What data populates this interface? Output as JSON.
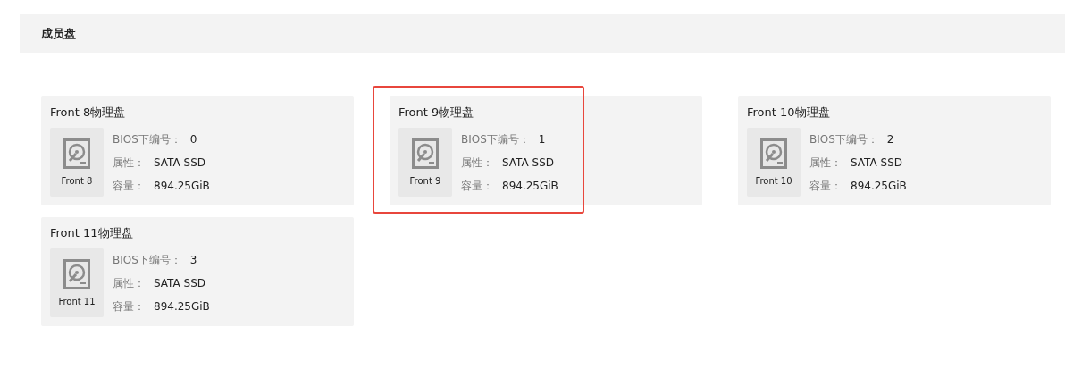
{
  "section": {
    "title": "成员盘"
  },
  "disks": [
    {
      "title": "Front 8物理盘",
      "icon_label": "Front 8",
      "highlighted": false,
      "fields": [
        {
          "label": "BIOS下编号：",
          "value": "0"
        },
        {
          "label": "属性：",
          "value": "SATA SSD"
        },
        {
          "label": "容量：",
          "value": "894.25GiB"
        }
      ]
    },
    {
      "title": "Front 9物理盘",
      "icon_label": "Front 9",
      "highlighted": true,
      "fields": [
        {
          "label": "BIOS下编号：",
          "value": "1"
        },
        {
          "label": "属性：",
          "value": "SATA SSD"
        },
        {
          "label": "容量：",
          "value": "894.25GiB"
        }
      ]
    },
    {
      "title": "Front 10物理盘",
      "icon_label": "Front 10",
      "highlighted": false,
      "fields": [
        {
          "label": "BIOS下编号：",
          "value": "2"
        },
        {
          "label": "属性：",
          "value": "SATA SSD"
        },
        {
          "label": "容量：",
          "value": "894.25GiB"
        }
      ]
    },
    {
      "title": "Front 11物理盘",
      "icon_label": "Front 11",
      "highlighted": false,
      "fields": [
        {
          "label": "BIOS下编号：",
          "value": "3"
        },
        {
          "label": "属性：",
          "value": "SATA SSD"
        },
        {
          "label": "容量：",
          "value": "894.25GiB"
        }
      ]
    }
  ]
}
